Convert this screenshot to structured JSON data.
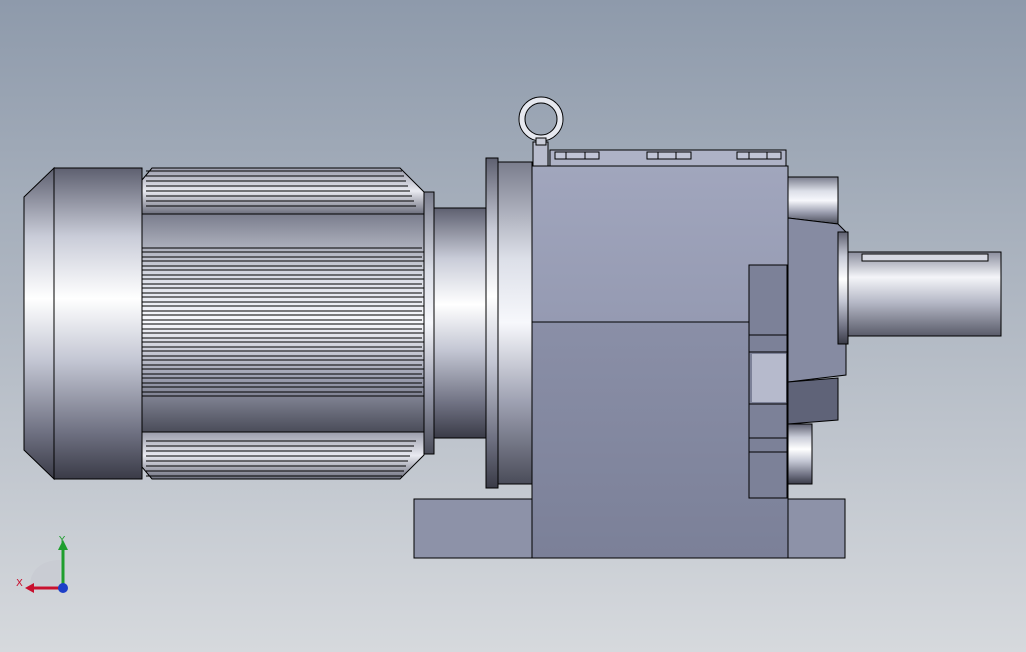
{
  "viewport": {
    "background_top": "#8e9aab",
    "background_bottom": "#d6d9dd"
  },
  "model": {
    "name": "gear-motor",
    "colors": {
      "motor_light": "#eef0f6",
      "motor_mid": "#a9adbd",
      "motor_dark": "#3c3e4c",
      "gearbox_face": "#9aa0b7",
      "gearbox_shadow": "#777c93",
      "edge": "#000000"
    }
  },
  "triad": {
    "x_label": "X",
    "y_label": "Y",
    "x_color": "#c8102e",
    "y_color": "#1f9e2e",
    "z_color": "#1d3fc8"
  }
}
